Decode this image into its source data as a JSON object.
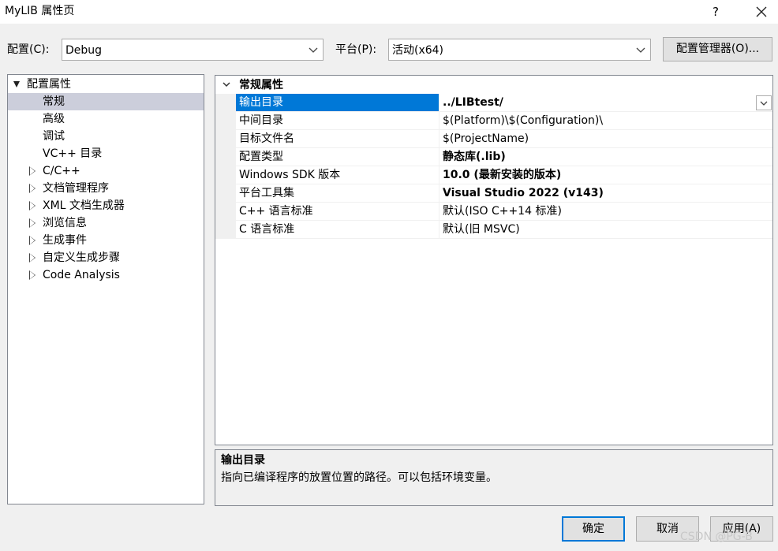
{
  "window": {
    "title": "MyLIB 属性页",
    "help_label": "?"
  },
  "toolbar": {
    "config_label": "配置(C):",
    "config_value": "Debug",
    "platform_label": "平台(P):",
    "platform_value": "活动(x64)",
    "config_manager_label": "配置管理器(O)..."
  },
  "tree": {
    "root": "配置属性",
    "items": [
      {
        "label": "常规",
        "selected": true,
        "expandable": false
      },
      {
        "label": "高级",
        "selected": false,
        "expandable": false
      },
      {
        "label": "调试",
        "selected": false,
        "expandable": false
      },
      {
        "label": "VC++ 目录",
        "selected": false,
        "expandable": false
      },
      {
        "label": "C/C++",
        "selected": false,
        "expandable": true
      },
      {
        "label": "文档管理程序",
        "selected": false,
        "expandable": true
      },
      {
        "label": "XML 文档生成器",
        "selected": false,
        "expandable": true
      },
      {
        "label": "浏览信息",
        "selected": false,
        "expandable": true
      },
      {
        "label": "生成事件",
        "selected": false,
        "expandable": true
      },
      {
        "label": "自定义生成步骤",
        "selected": false,
        "expandable": true
      },
      {
        "label": "Code Analysis",
        "selected": false,
        "expandable": true
      }
    ]
  },
  "grid": {
    "category": "常规属性",
    "rows": [
      {
        "name": "输出目录",
        "value": "../LIBtest/",
        "bold": true,
        "selected": true
      },
      {
        "name": "中间目录",
        "value": "$(Platform)\\$(Configuration)\\",
        "bold": false,
        "selected": false
      },
      {
        "name": "目标文件名",
        "value": "$(ProjectName)",
        "bold": false,
        "selected": false
      },
      {
        "name": "配置类型",
        "value": "静态库(.lib)",
        "bold": true,
        "selected": false
      },
      {
        "name": "Windows SDK 版本",
        "value": "10.0 (最新安装的版本)",
        "bold": true,
        "selected": false
      },
      {
        "name": "平台工具集",
        "value": "Visual Studio 2022 (v143)",
        "bold": true,
        "selected": false
      },
      {
        "name": "C++ 语言标准",
        "value": "默认(ISO C++14 标准)",
        "bold": false,
        "selected": false
      },
      {
        "name": "C 语言标准",
        "value": "默认(旧 MSVC)",
        "bold": false,
        "selected": false
      }
    ]
  },
  "description": {
    "title": "输出目录",
    "text": "指向已编译程序的放置位置的路径。可以包括环境变量。"
  },
  "buttons": {
    "ok": "确定",
    "cancel": "取消",
    "apply": "应用(A)"
  },
  "watermark": "CSDN @PG-B",
  "colors": {
    "selection_blue": "#0078d7",
    "tree_selection": "#cccedb"
  }
}
